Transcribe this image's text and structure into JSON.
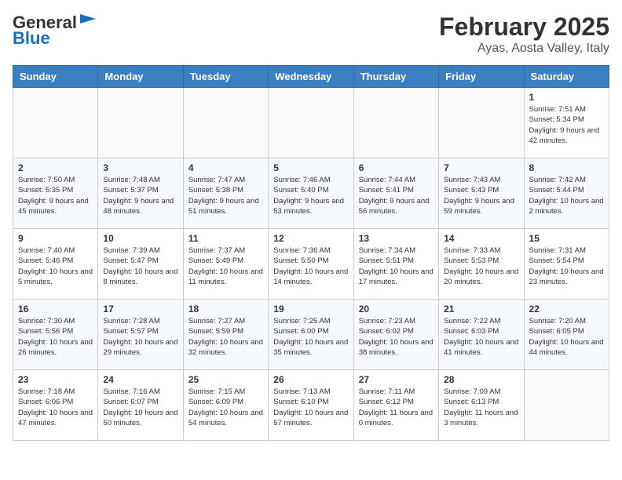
{
  "header": {
    "logo_general": "General",
    "logo_blue": "Blue",
    "month": "February 2025",
    "location": "Ayas, Aosta Valley, Italy"
  },
  "weekdays": [
    "Sunday",
    "Monday",
    "Tuesday",
    "Wednesday",
    "Thursday",
    "Friday",
    "Saturday"
  ],
  "weeks": [
    [
      {
        "day": "",
        "info": ""
      },
      {
        "day": "",
        "info": ""
      },
      {
        "day": "",
        "info": ""
      },
      {
        "day": "",
        "info": ""
      },
      {
        "day": "",
        "info": ""
      },
      {
        "day": "",
        "info": ""
      },
      {
        "day": "1",
        "info": "Sunrise: 7:51 AM\nSunset: 5:34 PM\nDaylight: 9 hours and 42 minutes."
      }
    ],
    [
      {
        "day": "2",
        "info": "Sunrise: 7:50 AM\nSunset: 5:35 PM\nDaylight: 9 hours and 45 minutes."
      },
      {
        "day": "3",
        "info": "Sunrise: 7:48 AM\nSunset: 5:37 PM\nDaylight: 9 hours and 48 minutes."
      },
      {
        "day": "4",
        "info": "Sunrise: 7:47 AM\nSunset: 5:38 PM\nDaylight: 9 hours and 51 minutes."
      },
      {
        "day": "5",
        "info": "Sunrise: 7:46 AM\nSunset: 5:40 PM\nDaylight: 9 hours and 53 minutes."
      },
      {
        "day": "6",
        "info": "Sunrise: 7:44 AM\nSunset: 5:41 PM\nDaylight: 9 hours and 56 minutes."
      },
      {
        "day": "7",
        "info": "Sunrise: 7:43 AM\nSunset: 5:43 PM\nDaylight: 9 hours and 59 minutes."
      },
      {
        "day": "8",
        "info": "Sunrise: 7:42 AM\nSunset: 5:44 PM\nDaylight: 10 hours and 2 minutes."
      }
    ],
    [
      {
        "day": "9",
        "info": "Sunrise: 7:40 AM\nSunset: 5:46 PM\nDaylight: 10 hours and 5 minutes."
      },
      {
        "day": "10",
        "info": "Sunrise: 7:39 AM\nSunset: 5:47 PM\nDaylight: 10 hours and 8 minutes."
      },
      {
        "day": "11",
        "info": "Sunrise: 7:37 AM\nSunset: 5:49 PM\nDaylight: 10 hours and 11 minutes."
      },
      {
        "day": "12",
        "info": "Sunrise: 7:36 AM\nSunset: 5:50 PM\nDaylight: 10 hours and 14 minutes."
      },
      {
        "day": "13",
        "info": "Sunrise: 7:34 AM\nSunset: 5:51 PM\nDaylight: 10 hours and 17 minutes."
      },
      {
        "day": "14",
        "info": "Sunrise: 7:33 AM\nSunset: 5:53 PM\nDaylight: 10 hours and 20 minutes."
      },
      {
        "day": "15",
        "info": "Sunrise: 7:31 AM\nSunset: 5:54 PM\nDaylight: 10 hours and 23 minutes."
      }
    ],
    [
      {
        "day": "16",
        "info": "Sunrise: 7:30 AM\nSunset: 5:56 PM\nDaylight: 10 hours and 26 minutes."
      },
      {
        "day": "17",
        "info": "Sunrise: 7:28 AM\nSunset: 5:57 PM\nDaylight: 10 hours and 29 minutes."
      },
      {
        "day": "18",
        "info": "Sunrise: 7:27 AM\nSunset: 5:59 PM\nDaylight: 10 hours and 32 minutes."
      },
      {
        "day": "19",
        "info": "Sunrise: 7:25 AM\nSunset: 6:00 PM\nDaylight: 10 hours and 35 minutes."
      },
      {
        "day": "20",
        "info": "Sunrise: 7:23 AM\nSunset: 6:02 PM\nDaylight: 10 hours and 38 minutes."
      },
      {
        "day": "21",
        "info": "Sunrise: 7:22 AM\nSunset: 6:03 PM\nDaylight: 10 hours and 41 minutes."
      },
      {
        "day": "22",
        "info": "Sunrise: 7:20 AM\nSunset: 6:05 PM\nDaylight: 10 hours and 44 minutes."
      }
    ],
    [
      {
        "day": "23",
        "info": "Sunrise: 7:18 AM\nSunset: 6:06 PM\nDaylight: 10 hours and 47 minutes."
      },
      {
        "day": "24",
        "info": "Sunrise: 7:16 AM\nSunset: 6:07 PM\nDaylight: 10 hours and 50 minutes."
      },
      {
        "day": "25",
        "info": "Sunrise: 7:15 AM\nSunset: 6:09 PM\nDaylight: 10 hours and 54 minutes."
      },
      {
        "day": "26",
        "info": "Sunrise: 7:13 AM\nSunset: 6:10 PM\nDaylight: 10 hours and 57 minutes."
      },
      {
        "day": "27",
        "info": "Sunrise: 7:11 AM\nSunset: 6:12 PM\nDaylight: 11 hours and 0 minutes."
      },
      {
        "day": "28",
        "info": "Sunrise: 7:09 AM\nSunset: 6:13 PM\nDaylight: 11 hours and 3 minutes."
      },
      {
        "day": "",
        "info": ""
      }
    ]
  ]
}
